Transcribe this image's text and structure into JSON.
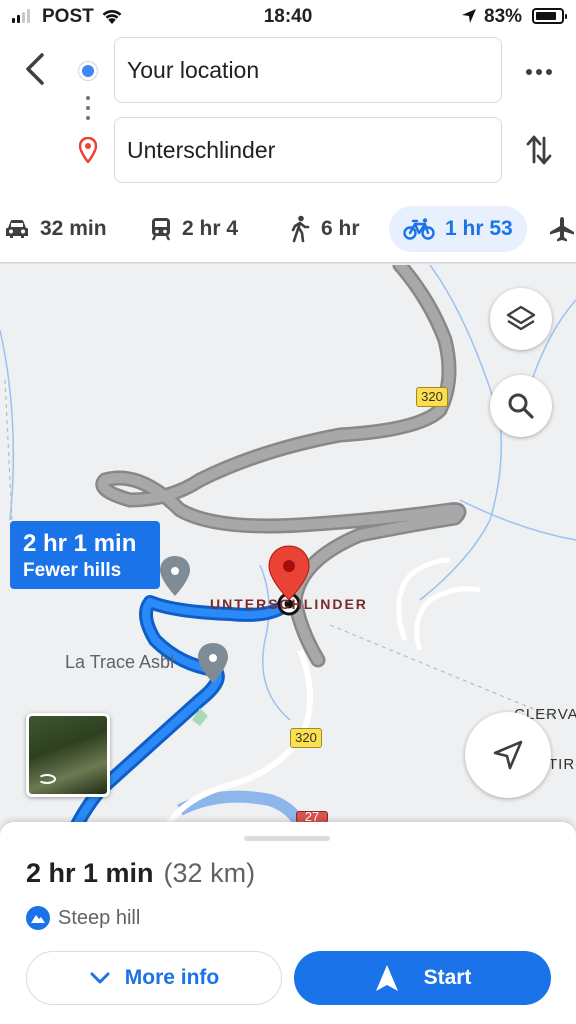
{
  "status_bar": {
    "carrier": "POST",
    "time": "18:40",
    "battery_percent": "83%",
    "battery_level": 0.83,
    "signal_bars": 2,
    "icons": [
      "signal-icon",
      "wifi-icon",
      "location-arrow-icon",
      "battery-icon"
    ]
  },
  "directions": {
    "origin": "Your location",
    "destination": "Unterschlinder"
  },
  "modes": [
    {
      "icon": "car-icon",
      "label": "32 min",
      "active": false
    },
    {
      "icon": "train-icon",
      "label": "2 hr 4",
      "active": false
    },
    {
      "icon": "walking-icon",
      "label": "6 hr",
      "active": false
    },
    {
      "icon": "bicycle-icon",
      "label": "1 hr 53",
      "active": true
    },
    {
      "icon": "airplane-icon",
      "label": "",
      "active": false
    }
  ],
  "map": {
    "route_callout": {
      "duration": "2 hr 1 min",
      "note": "Fewer hills"
    },
    "place_label": "La Trace Asbl",
    "town_label": "UNTERSCHLINDER",
    "road_badges": [
      "320",
      "320",
      "27"
    ],
    "partial_labels": [
      "CLERVA",
      "TIRO"
    ]
  },
  "sheet": {
    "duration": "2 hr 1 min",
    "distance": "(32 km)",
    "warning": "Steep hill",
    "more_info_label": "More info",
    "start_label": "Start"
  },
  "colors": {
    "accent": "#1a73e8",
    "route": "#1a73e8",
    "alt_route": "#a0a0a0",
    "pin": "#ea4335",
    "map_bg": "#eef0f2",
    "road_badge": "#fbdf4c"
  }
}
